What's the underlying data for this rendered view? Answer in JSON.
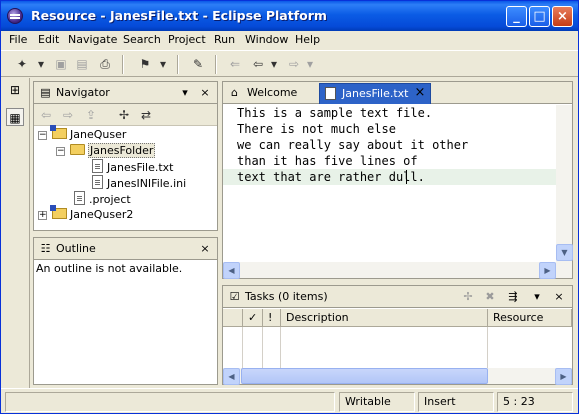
{
  "window": {
    "title": "Resource - JanesFile.txt - Eclipse Platform",
    "minimize_glyph": "_",
    "maximize_glyph": "□",
    "close_glyph": "×"
  },
  "menubar": {
    "items": [
      "File",
      "Edit",
      "Navigate",
      "Search",
      "Project",
      "Run",
      "Window",
      "Help"
    ]
  },
  "toolbar": {
    "icons": [
      "new-wizard-icon",
      "save-icon",
      "save-all-icon",
      "print-icon",
      "run-icon",
      "pin-icon",
      "last-edit-location-icon",
      "back-icon",
      "forward-icon"
    ]
  },
  "perspective_bar": {
    "icons": [
      "open-perspective-icon",
      "resource-perspective-icon"
    ]
  },
  "navigator": {
    "title": "Navigator",
    "tree": [
      {
        "label": "JaneQuser",
        "type": "project",
        "expanded": true
      },
      {
        "label": "JanesFolder",
        "type": "folder",
        "expanded": true,
        "selected": true
      },
      {
        "label": "JanesFile.txt",
        "type": "file"
      },
      {
        "label": "JanesINIFile.ini",
        "type": "file"
      },
      {
        "label": ".project",
        "type": "file"
      },
      {
        "label": "JaneQuser2",
        "type": "project",
        "expanded": false
      }
    ]
  },
  "outline": {
    "title": "Outline",
    "message": "An outline is not available."
  },
  "editor": {
    "tabs": [
      {
        "label": "Welcome",
        "active": false
      },
      {
        "label": "JanesFile.txt",
        "active": true
      }
    ],
    "lines": [
      "This is a sample text file.",
      "There is not much else",
      "we can really say about it other",
      "than it has five lines of",
      "text that are rather dull."
    ],
    "current_line": 5
  },
  "tasks": {
    "title": "Tasks (0 items)",
    "columns": [
      "",
      "✓",
      "!",
      "Description",
      "Resource"
    ]
  },
  "status": {
    "writable": "Writable",
    "insert_mode": "Insert",
    "position": "5 : 23"
  },
  "colors": {
    "title_bar": "#0b5ce5",
    "active_tab": "#2d63c8",
    "current_line_highlight": "#e8f2e8"
  }
}
